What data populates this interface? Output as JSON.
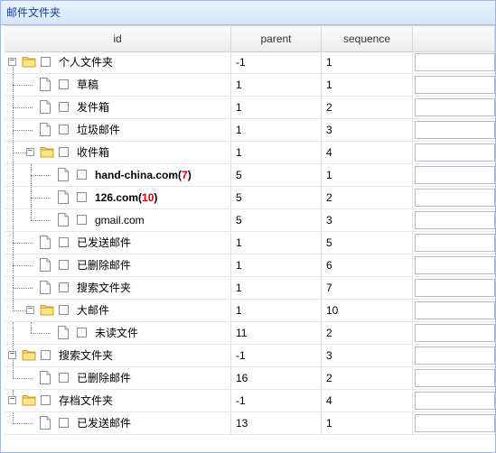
{
  "panel": {
    "title": "邮件文件夹"
  },
  "columns": {
    "id": "id",
    "parent": "parent",
    "sequence": "sequence"
  },
  "rows": [
    {
      "label": "个人文件夹",
      "parent": "-1",
      "sequence": "1"
    },
    {
      "label": "草稿",
      "parent": "1",
      "sequence": "1"
    },
    {
      "label": "发件箱",
      "parent": "1",
      "sequence": "2"
    },
    {
      "label": "垃圾邮件",
      "parent": "1",
      "sequence": "3"
    },
    {
      "label": "收件箱",
      "parent": "1",
      "sequence": "4"
    },
    {
      "label": "hand-china.com",
      "count": "7",
      "parent": "5",
      "sequence": "1"
    },
    {
      "label": "126.com",
      "count": "10",
      "parent": "5",
      "sequence": "2"
    },
    {
      "label": "gmail.com",
      "parent": "5",
      "sequence": "3"
    },
    {
      "label": "已发送邮件",
      "parent": "1",
      "sequence": "5"
    },
    {
      "label": "已删除邮件",
      "parent": "1",
      "sequence": "6"
    },
    {
      "label": "搜索文件夹",
      "parent": "1",
      "sequence": "7"
    },
    {
      "label": "大邮件",
      "parent": "1",
      "sequence": "10"
    },
    {
      "label": "未读文件",
      "parent": "11",
      "sequence": "2"
    },
    {
      "label": "搜索文件夹",
      "parent": "-1",
      "sequence": "3"
    },
    {
      "label": "已删除邮件",
      "parent": "16",
      "sequence": "2"
    },
    {
      "label": "存档文件夹",
      "parent": "-1",
      "sequence": "4"
    },
    {
      "label": "已发送邮件",
      "parent": "13",
      "sequence": "1"
    }
  ]
}
